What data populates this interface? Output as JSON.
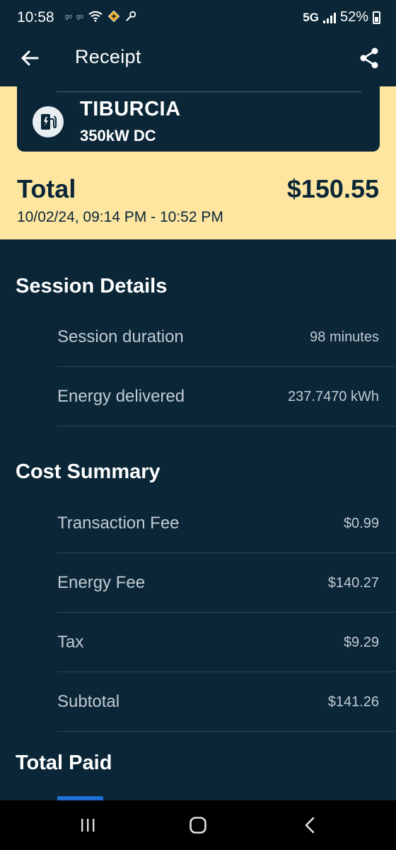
{
  "status_bar": {
    "time": "10:58",
    "small_left_1": "go",
    "small_left_2": "go",
    "network": "5G",
    "battery": "52%"
  },
  "app_bar": {
    "title": "Receipt",
    "back_icon": "arrow-left-icon",
    "share_icon": "share-icon"
  },
  "station": {
    "name": "TIBURCIA",
    "power": "350kW DC",
    "icon": "ev-charger-icon"
  },
  "total": {
    "label": "Total",
    "amount": "$150.55",
    "range": "10/02/24, 09:14 PM - 10:52 PM"
  },
  "session_details": {
    "title": "Session Details",
    "rows": [
      {
        "label": "Session duration",
        "value": "98 minutes"
      },
      {
        "label": "Energy delivered",
        "value": "237.7470 kWh"
      }
    ]
  },
  "cost_summary": {
    "title": "Cost Summary",
    "rows": [
      {
        "label": "Transaction Fee",
        "value": "$0.99"
      },
      {
        "label": "Energy Fee",
        "value": "$140.27"
      },
      {
        "label": "Tax",
        "value": "$9.29"
      },
      {
        "label": "Subtotal",
        "value": "$141.26"
      }
    ]
  },
  "total_paid": {
    "title": "Total Paid"
  },
  "nav_bar": {
    "recents_icon": "recents-icon",
    "home_icon": "home-icon",
    "back_icon": "back-chevron-icon"
  },
  "colors": {
    "background": "#0a2637",
    "accent_yellow": "#fee6a1",
    "muted_text": "#c0cbd2"
  }
}
